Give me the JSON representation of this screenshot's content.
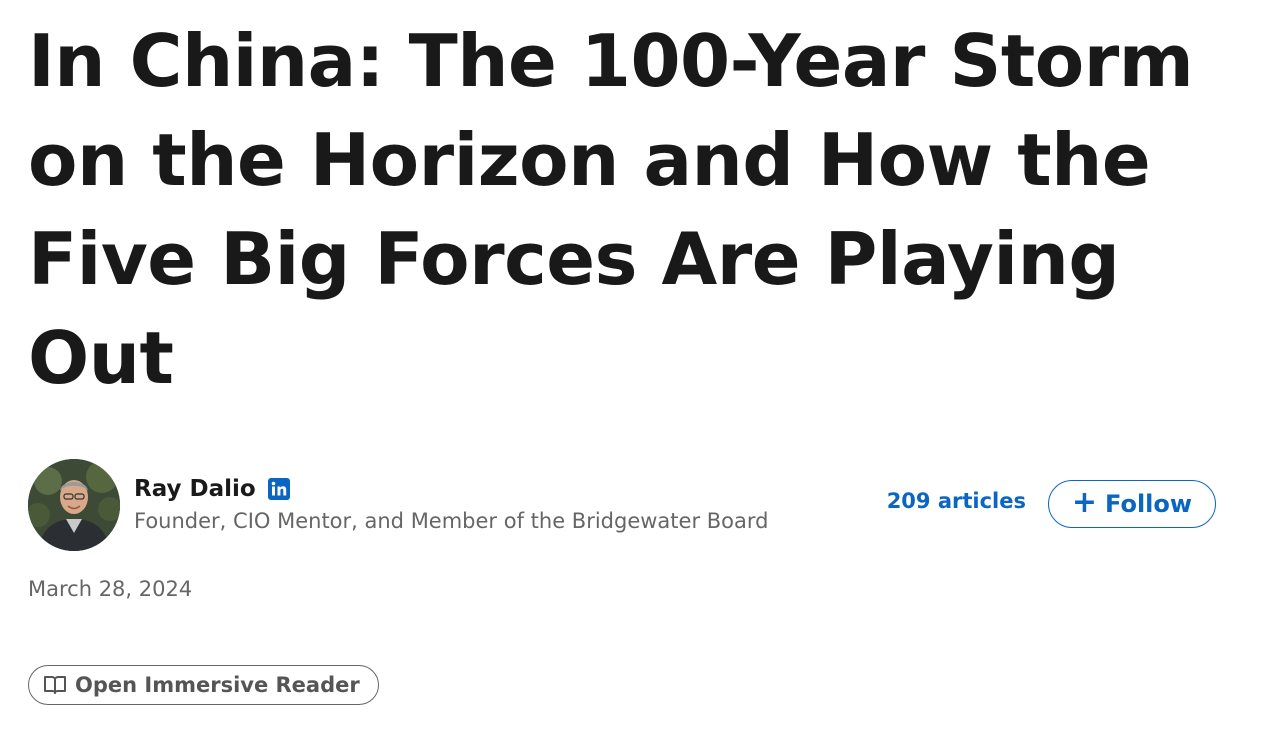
{
  "article": {
    "title": "In China: The 100-Year Storm on the Horizon and How the Five Big Forces Are Playing Out",
    "date": "March 28, 2024"
  },
  "author": {
    "name": "Ray Dalio",
    "headline": "Founder, CIO Mentor, and Member of the Bridgewater Board",
    "badge_icon": "linkedin-icon",
    "articles_count_label": "209 articles"
  },
  "actions": {
    "follow_icon": "plus-icon",
    "follow_label": "Follow",
    "reader_icon": "book-icon",
    "reader_label": "Open Immersive Reader"
  },
  "colors": {
    "brand_blue": "#0a66c2",
    "title_text": "#191919",
    "muted_text": "#666666"
  }
}
